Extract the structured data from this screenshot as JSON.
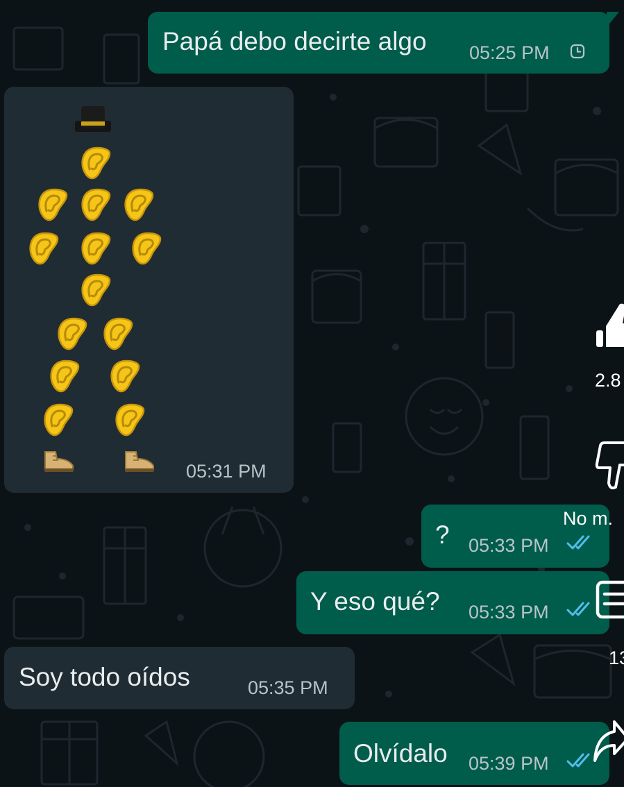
{
  "messages": [
    {
      "text": "Papá debo decirte algo",
      "time": "05:25 PM",
      "direction": "outgoing",
      "status": "pending-clock-icon"
    },
    {
      "type": "emoji-art",
      "time": "05:31 PM",
      "direction": "incoming",
      "emojis": [
        "top-hat",
        "ear",
        "boot"
      ]
    },
    {
      "text": "?",
      "time": "05:33 PM",
      "direction": "outgoing",
      "status": "double-check-icon"
    },
    {
      "text": "Y eso qué?",
      "time": "05:33 PM",
      "direction": "outgoing",
      "status": "double-check-icon"
    },
    {
      "text": "Soy todo oídos",
      "time": "05:35 PM",
      "direction": "incoming"
    },
    {
      "text": "Olvídalo",
      "time": "05:39 PM",
      "direction": "outgoing",
      "status": "double-check-icon"
    }
  ],
  "side_actions": {
    "like_count": "2.8",
    "dislike_label": "No m.",
    "comment_count": "13"
  },
  "colors": {
    "background": "#0c1317",
    "outgoing_bubble": "#005c4b",
    "incoming_bubble": "#202c33",
    "read_tick": "#53bdeb",
    "ear": "#f5c518"
  }
}
